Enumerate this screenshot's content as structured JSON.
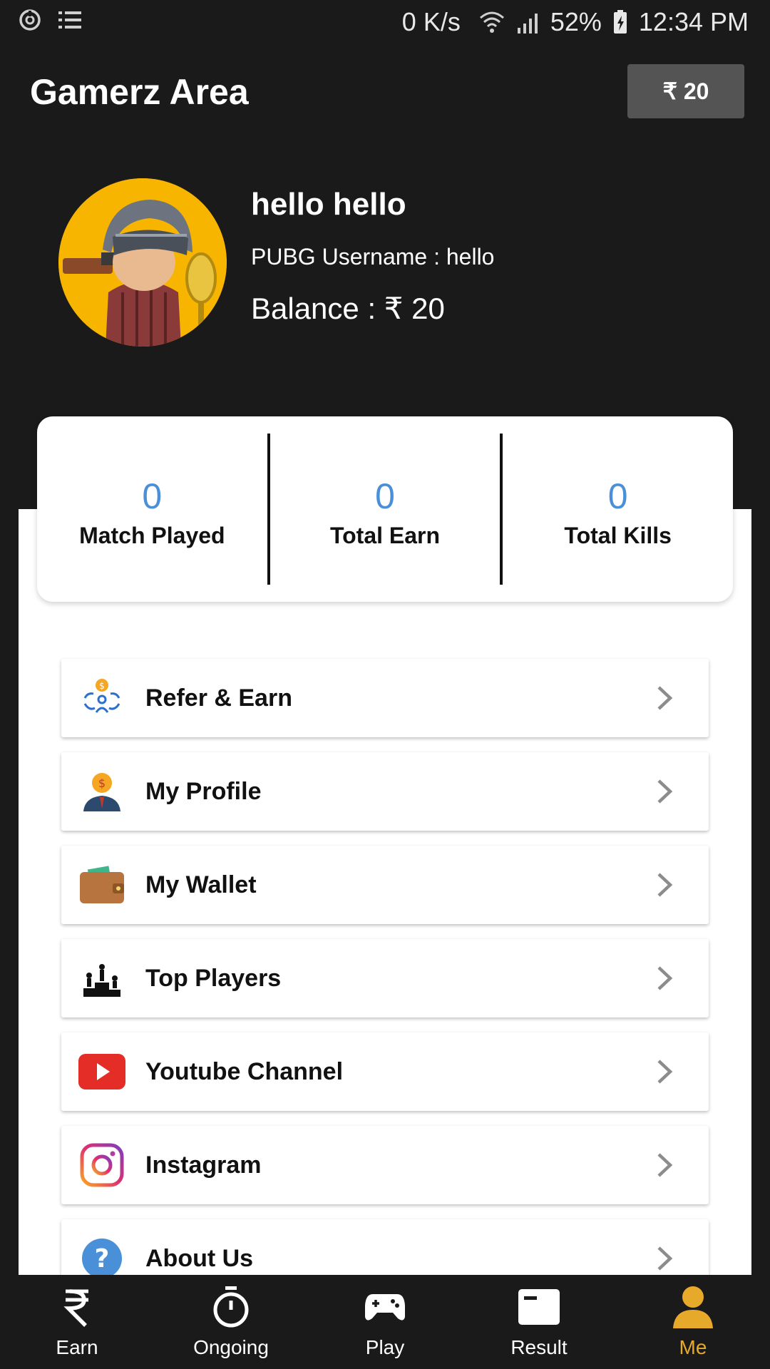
{
  "status_bar": {
    "net_speed": "0 K/s",
    "battery": "52%",
    "time": "12:34 PM"
  },
  "app": {
    "title": "Gamerz Area",
    "balance_chip": "₹ 20"
  },
  "profile": {
    "name": "hello hello",
    "pubg_username": "PUBG Username : hello",
    "balance": "Balance : ₹ 20",
    "avatar_icon": "pubg-character-avatar"
  },
  "stats": [
    {
      "value": "0",
      "label": "Match Played"
    },
    {
      "value": "0",
      "label": "Total Earn"
    },
    {
      "value": "0",
      "label": "Total Kills"
    }
  ],
  "menu": [
    {
      "label": "Refer & Earn",
      "icon": "refer-earn-icon"
    },
    {
      "label": "My Profile",
      "icon": "profile-icon"
    },
    {
      "label": "My Wallet",
      "icon": "wallet-icon"
    },
    {
      "label": "Top Players",
      "icon": "podium-icon"
    },
    {
      "label": "Youtube Channel",
      "icon": "youtube-icon"
    },
    {
      "label": "Instagram",
      "icon": "instagram-icon"
    },
    {
      "label": "About Us",
      "icon": "help-icon"
    }
  ],
  "bottom_nav": [
    {
      "label": "Earn",
      "icon": "rupee-icon"
    },
    {
      "label": "Ongoing",
      "icon": "stopwatch-icon"
    },
    {
      "label": "Play",
      "icon": "gamepad-icon"
    },
    {
      "label": "Result",
      "icon": "result-icon"
    },
    {
      "label": "Me",
      "icon": "person-icon",
      "active": true
    }
  ],
  "colors": {
    "background": "#1a1a1a",
    "stat_value": "#4a90d9",
    "active_nav": "#e6a92a",
    "chip": "#545454",
    "avatar_bg": "#f7b500"
  }
}
